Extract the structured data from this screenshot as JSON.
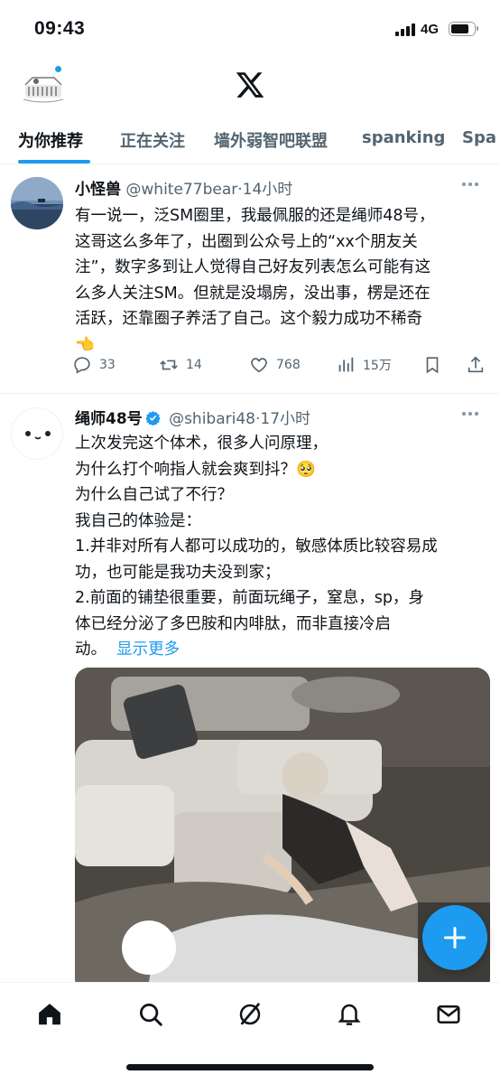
{
  "status_bar": {
    "time": "09:43",
    "network": "4G"
  },
  "header": {
    "logo_icon": "x-logo-icon",
    "accent_color": "#1d9bf0"
  },
  "tabs": [
    {
      "label": "为你推荐",
      "active": true
    },
    {
      "label": "正在关注",
      "active": false
    },
    {
      "label": "墙外弱智吧联盟",
      "active": false
    },
    {
      "label": "spanking",
      "active": false
    },
    {
      "label": "Spa",
      "active": false
    }
  ],
  "tweets": [
    {
      "name": "小怪兽",
      "handle": "@white77bear",
      "time": "·14小时",
      "lines": [
        "有一说一，泛SM圈里，我最佩服的还是绳师48号，",
        "这哥这么多年了，出圈到公众号上的“xx个朋友关",
        "注”，数字多到让人觉得自己好友列表怎么可能有这",
        "么多人关注SM。但就是没塌房，没出事，楞是还在",
        "活跃，还靠圈子养活了自己。这个毅力成功不稀奇"
      ],
      "emoji": "👈",
      "replies": "33",
      "reposts": "14",
      "likes": "768",
      "views": "15万"
    },
    {
      "name": "绳师48号",
      "handle": "@shibari48",
      "time": "·17小时",
      "lines": [
        "上次发完这个体术，很多人问原理，",
        "为什么打个响指人就会爽到抖？🥺",
        "为什么自己试了不行？",
        "我自己的体验是：",
        "1.并非对所有人都可以成功的，敏感体质比较容易成",
        "功，也可能是我功夫没到家；",
        "2.前面的铺垫很重要，前面玩绳子，窒息，sp，身",
        "体已经分泌了多巴胺和内啡肽，而非直接冷启",
        "动。"
      ],
      "show_more": "显示更多"
    }
  ]
}
